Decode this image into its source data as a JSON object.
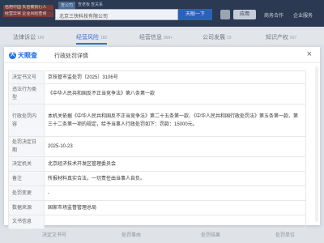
{
  "background": {
    "logo_lines": [
      "信用中国 失信被执行人",
      "经营异常 企业风险查询"
    ],
    "search_tabs": [
      "查公司",
      "查老板",
      "查关系"
    ],
    "search_value": "北京三快科技有限公司",
    "search_button": "天眼一下",
    "app_label": "应用",
    "nav_links": [
      "商务合作",
      "企业服务"
    ],
    "tabs": [
      {
        "label": "法律诉讼",
        "count": "149"
      },
      {
        "label": "经营风险",
        "count": "182"
      },
      {
        "label": "经营信息",
        "count": "999+"
      },
      {
        "label": "公司发展",
        "count": "23"
      },
      {
        "label": "知识产权",
        "count": "657"
      }
    ],
    "footer_cols": [
      "决定文书号",
      "处罚事由",
      "处罚结果",
      "处罚单位"
    ]
  },
  "modal": {
    "brand": "天眼查",
    "brand_mark": "天",
    "title": "行政处罚详情",
    "close": "×",
    "rows": [
      {
        "label": "决定书文号",
        "value": "京技管市监处罚〔2025〕3106号"
      },
      {
        "label": "违法行为类型",
        "value": "《中华人民共和国反不正当竞争法》第八条第一款"
      },
      {
        "label": "行政处罚内容",
        "value": "本机关依据《中华人民共和国反不正当竞争法》第二十五条第一款、《中华人民共和国行政处罚法》第五条第一款、第三十二条第一项的规定，给予当事人行政处罚如下：罚款：15000元。"
      },
      {
        "label": "处罚决定日期",
        "value": "2025-10-23"
      },
      {
        "label": "决定机关",
        "value": "北京经济技术开发区管理委员会"
      },
      {
        "label": "备注",
        "value": "所报材料真实合法，一切责任由当事人自负。"
      },
      {
        "label": "处罚变更",
        "value": "-"
      },
      {
        "label": "数据来源",
        "value": "国家市场监督管理总局"
      },
      {
        "label": "文书信息",
        "value": ""
      }
    ]
  }
}
